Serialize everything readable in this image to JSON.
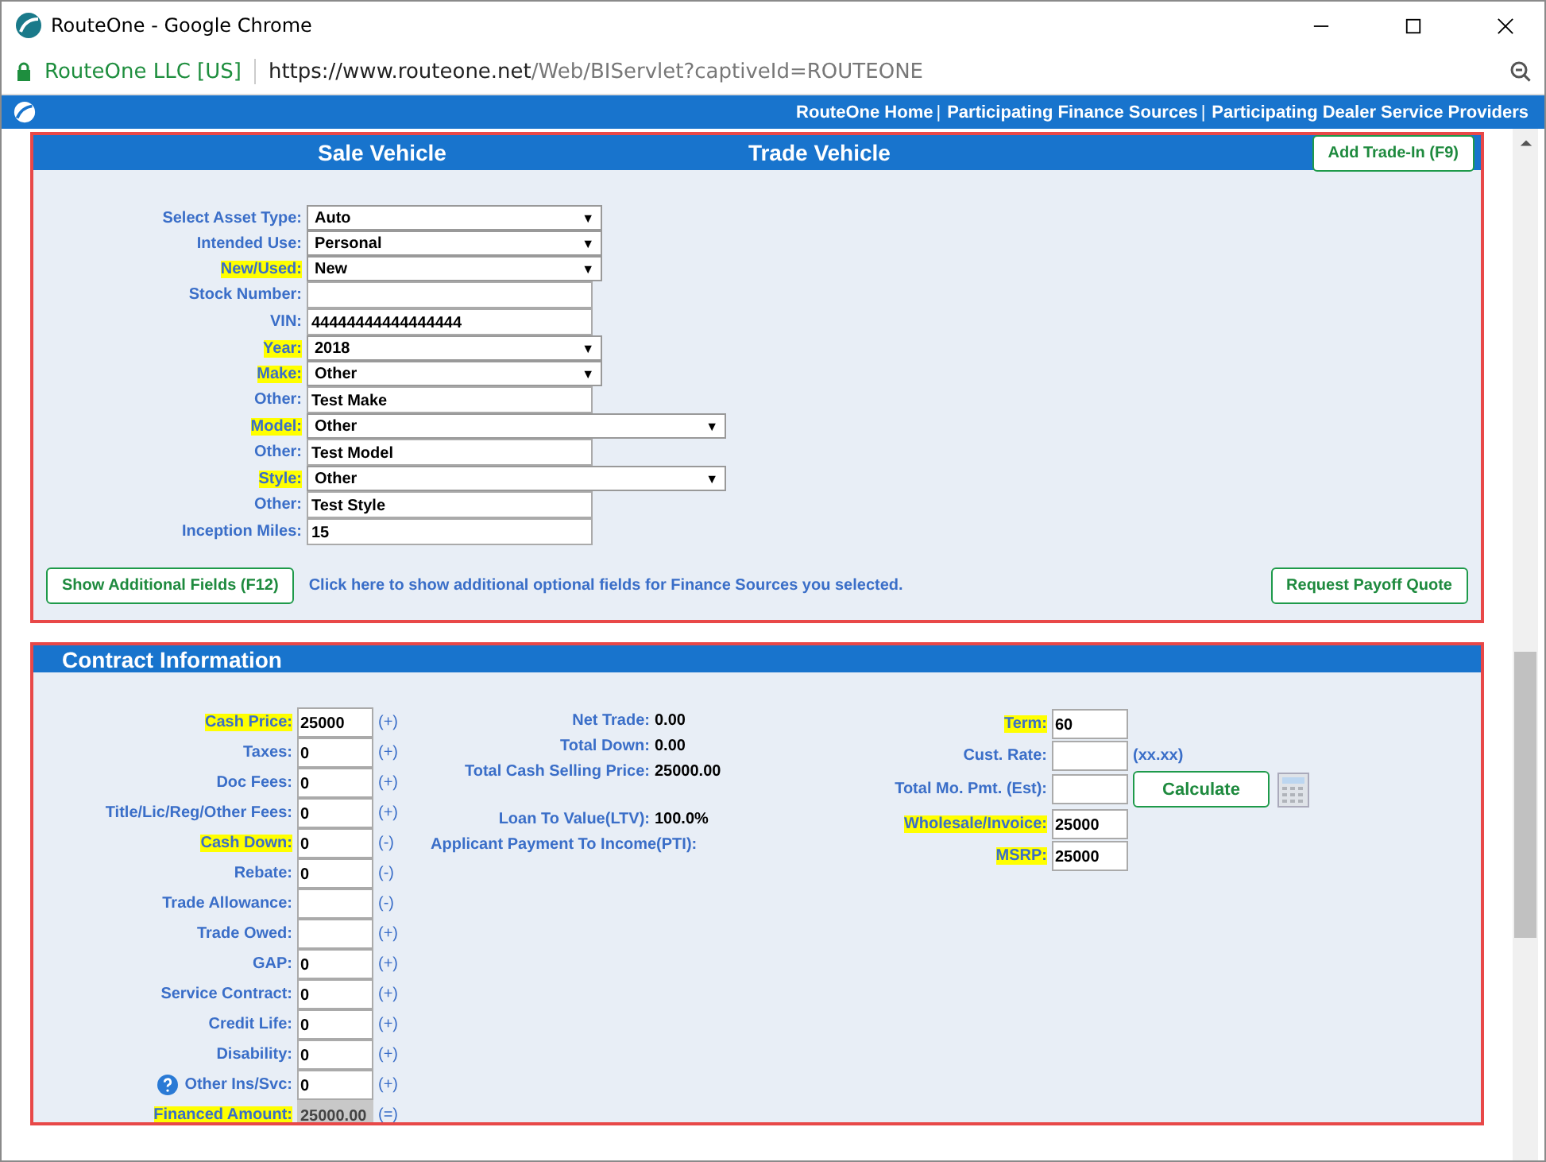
{
  "window": {
    "title": "RouteOne - Google Chrome"
  },
  "address": {
    "site": "RouteOne LLC [US]",
    "url_host": "https://www.routeone.net",
    "url_path": "/Web/BIServlet?captiveId=ROUTEONE"
  },
  "nav": [
    {
      "kind": "link",
      "label": "RouteOne Home"
    },
    {
      "kind": "separator",
      "label": "|"
    },
    {
      "kind": "link",
      "label": "Participating Finance Sources"
    },
    {
      "kind": "separator",
      "label": "|"
    },
    {
      "kind": "link",
      "label": "Participating Dealer Service Providers"
    }
  ],
  "vehicle": {
    "headings": [
      "Sale Vehicle",
      "Trade Vehicle"
    ],
    "add_button": "Add Trade-In (F9)",
    "fields": [
      {
        "label": "Select Asset Type:",
        "highlighted": false,
        "kind": "select",
        "wide": false,
        "value": "Auto"
      },
      {
        "label": "Intended Use:",
        "highlighted": false,
        "kind": "select",
        "wide": false,
        "value": "Personal"
      },
      {
        "label": "New/Used:",
        "highlighted": true,
        "kind": "select",
        "wide": false,
        "value": "New"
      },
      {
        "label": "Stock Number:",
        "highlighted": false,
        "kind": "text"
      },
      {
        "label": "VIN:",
        "highlighted": false,
        "kind": "text",
        "value": "44444444444444444"
      },
      {
        "label": "Year:",
        "highlighted": true,
        "kind": "select",
        "wide": false,
        "value": "2018"
      },
      {
        "label": "Make:",
        "highlighted": true,
        "kind": "select",
        "wide": false,
        "value": "Other"
      },
      {
        "label": "Other:",
        "highlighted": false,
        "kind": "text",
        "value": "Test Make"
      },
      {
        "label": "Model:",
        "highlighted": true,
        "kind": "select",
        "wide": true,
        "value": "Other"
      },
      {
        "label": "Other:",
        "highlighted": false,
        "kind": "text",
        "value": "Test Model"
      },
      {
        "label": "Style:",
        "highlighted": true,
        "kind": "select",
        "wide": true,
        "value": "Other"
      },
      {
        "label": "Other:",
        "highlighted": false,
        "kind": "text",
        "value": "Test Style"
      },
      {
        "label": "Inception Miles:",
        "highlighted": false,
        "kind": "text",
        "value": "15"
      }
    ],
    "select_arrow": "▼",
    "show_fields_button": "Show Additional Fields (F12)",
    "hint_link": "Click here to show additional optional fields for Finance Sources you selected.",
    "payoff_button": "Request Payoff Quote"
  },
  "contract": {
    "title": "Contract Information",
    "fields": [
      {
        "label": "Cash Price:",
        "highlighted": true,
        "kind": "input",
        "value": "25000",
        "sign": "(+)"
      },
      {
        "label": "Taxes:",
        "highlighted": false,
        "kind": "input",
        "value": "0",
        "sign": "(+)"
      },
      {
        "label": "Doc Fees:",
        "highlighted": false,
        "kind": "input",
        "value": "0",
        "sign": "(+)"
      },
      {
        "label": "Title/Lic/Reg/Other Fees:",
        "highlighted": false,
        "kind": "input",
        "value": "0",
        "sign": "(+)"
      },
      {
        "label": "Cash Down:",
        "highlighted": true,
        "kind": "input",
        "value": "0",
        "sign": "(-)"
      },
      {
        "label": "Rebate:",
        "highlighted": false,
        "kind": "input",
        "value": "0",
        "sign": "(-)"
      },
      {
        "label": "Trade Allowance:",
        "highlighted": false,
        "kind": "input",
        "sign": "(-)"
      },
      {
        "label": "Trade Owed:",
        "highlighted": false,
        "kind": "input",
        "sign": "(+)"
      },
      {
        "label": "GAP:",
        "highlighted": false,
        "kind": "input",
        "value": "0",
        "sign": "(+)"
      },
      {
        "label": "Service Contract:",
        "highlighted": false,
        "kind": "input",
        "value": "0",
        "sign": "(+)"
      },
      {
        "label": "Credit Life:",
        "highlighted": false,
        "kind": "input",
        "value": "0",
        "sign": "(+)"
      },
      {
        "label": "Disability:",
        "highlighted": false,
        "kind": "input",
        "value": "0",
        "sign": "(+)"
      },
      {
        "label": "Other Ins/Svc:",
        "highlighted": false,
        "kind": "help_input",
        "value": "0",
        "sign": "(+)"
      },
      {
        "label": "Financed Amount:",
        "highlighted": true,
        "kind": "readonly",
        "value": "25000.00",
        "sign": "(=)"
      }
    ],
    "summary_groups": [
      [
        {
          "label": "Net Trade:",
          "value": "0.00"
        },
        {
          "label": "Total Down:",
          "value": "0.00"
        },
        {
          "label": "Total Cash Selling Price:",
          "value": "25000.00"
        }
      ],
      [
        {
          "label": "Loan To Value(LTV):",
          "value": "100.0%"
        },
        {
          "label": "Applicant Payment To Income(PTI):"
        }
      ]
    ],
    "terms": [
      {
        "label": "Term:",
        "highlighted": true,
        "value": "60"
      },
      {
        "label": "Cust. Rate:",
        "highlighted": false,
        "note": "(xx.xx)"
      },
      {
        "label": "Total Mo. Pmt. (Est):",
        "highlighted": false,
        "button": "Calculate"
      },
      {
        "label": "Wholesale/Invoice:",
        "highlighted": true,
        "value": "25000"
      },
      {
        "label": "MSRP:",
        "highlighted": true,
        "value": "25000"
      }
    ]
  }
}
